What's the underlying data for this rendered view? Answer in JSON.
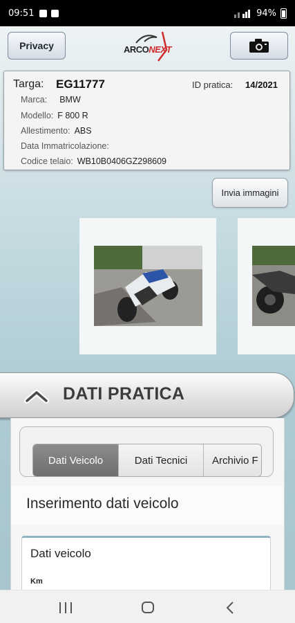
{
  "statusbar": {
    "time": "09:51",
    "battery": "94%"
  },
  "header": {
    "privacy_label": "Privacy",
    "logo_prefix": "ARCO",
    "logo_suffix": "NEXT"
  },
  "vehicle": {
    "targa_label": "Targa:",
    "targa": "EG11777",
    "id_pratica_label": "ID pratica:",
    "id_pratica": "14/2021",
    "fields": [
      {
        "label": "Marca:",
        "value": "BMW"
      },
      {
        "label": "Modello:",
        "value": "F 800 R"
      },
      {
        "label": "Allestimento:",
        "value": "ABS"
      },
      {
        "label": "Data Immatricolazione:",
        "value": ""
      },
      {
        "label": "Codice telaio:",
        "value": "WB10B0406GZ298609"
      }
    ]
  },
  "actions": {
    "invia_immagini": "Invia immagini"
  },
  "pratica": {
    "title": "DATI PRATICA",
    "tabs": [
      {
        "label": "Dati Veicolo",
        "active": true
      },
      {
        "label": "Dati Tecnici",
        "active": false
      },
      {
        "label": "Archivio F",
        "active": false
      }
    ],
    "section_title": "Inserimento dati veicolo",
    "card_title": "Dati veicolo",
    "km_label": "Km"
  }
}
